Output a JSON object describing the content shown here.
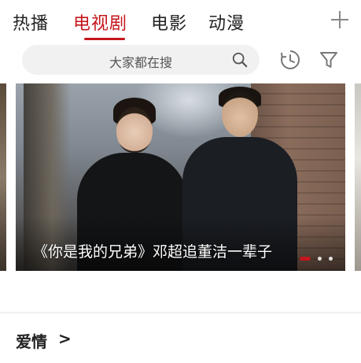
{
  "tabs": [
    {
      "label": "热播",
      "active": false
    },
    {
      "label": "电视剧",
      "active": true
    },
    {
      "label": "电影",
      "active": false
    },
    {
      "label": "动漫",
      "active": false
    }
  ],
  "accent_color": "#c4161c",
  "search": {
    "placeholder": "大家都在搜"
  },
  "icons": {
    "add": "plus-icon",
    "search": "search-icon",
    "history": "history-icon",
    "filter": "filter-icon"
  },
  "banner": {
    "caption": "《你是我的兄弟》邓超追董洁一辈子",
    "page_index": 1,
    "page_count": 3
  },
  "section": {
    "title": "爱情",
    "chevron": ">"
  }
}
